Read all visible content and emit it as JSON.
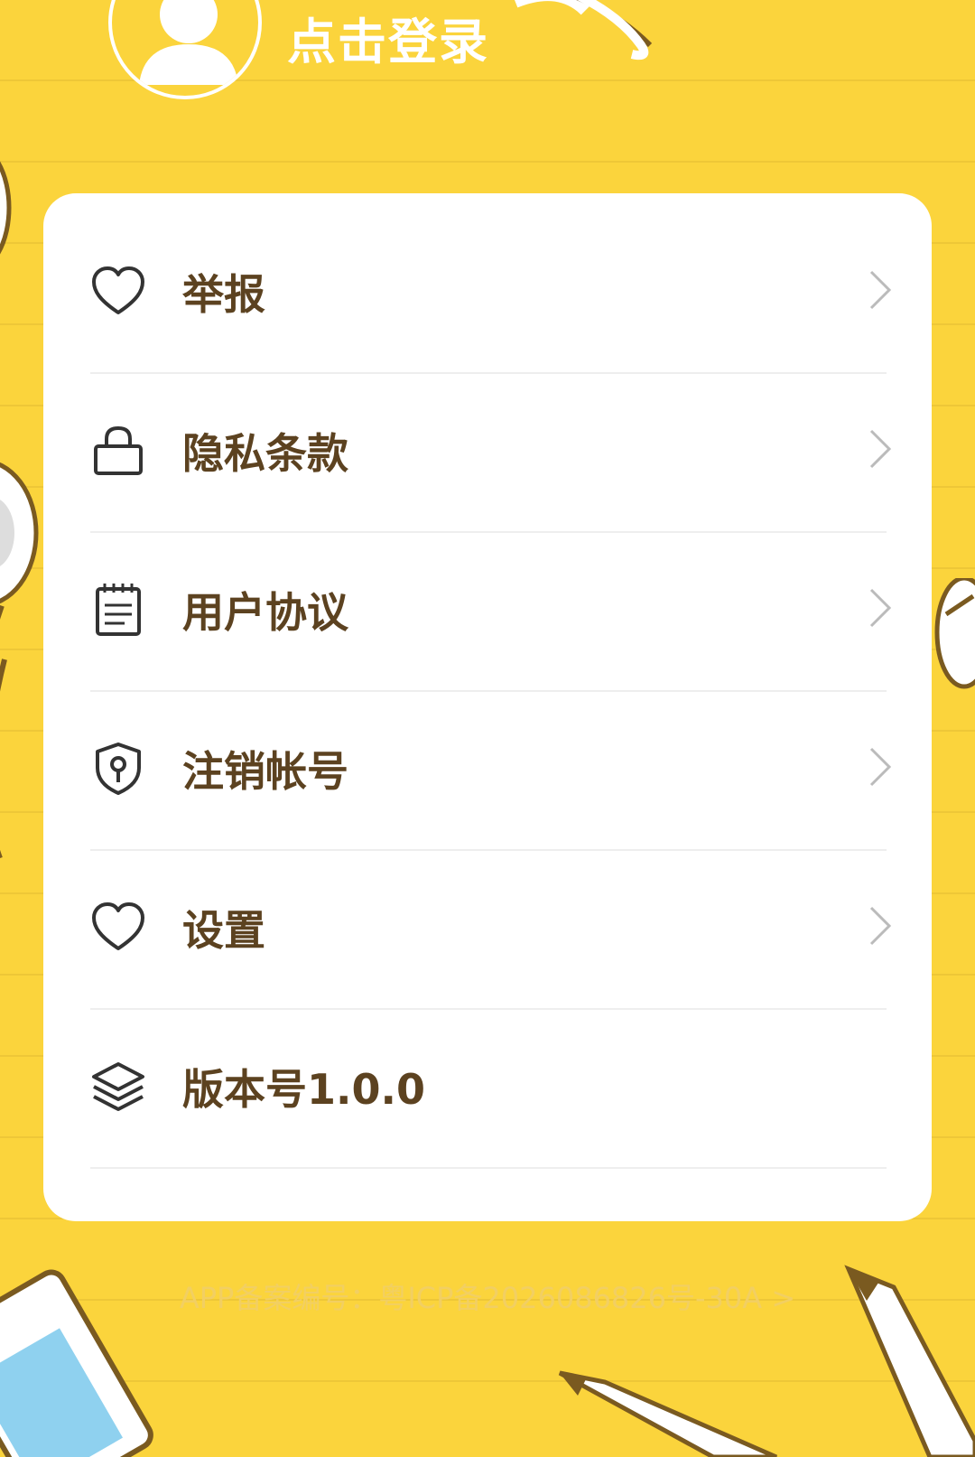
{
  "header": {
    "login_label": "点击登录",
    "avatar_icon": "user-avatar-icon"
  },
  "menu": {
    "items": [
      {
        "label": "举报",
        "icon": "heart-icon",
        "has_chevron": true
      },
      {
        "label": "隐私条款",
        "icon": "lock-icon",
        "has_chevron": true
      },
      {
        "label": "用户协议",
        "icon": "notepad-icon",
        "has_chevron": true
      },
      {
        "label": "注销帐号",
        "icon": "shield-key-icon",
        "has_chevron": true
      },
      {
        "label": "设置",
        "icon": "heart-icon",
        "has_chevron": true
      },
      {
        "label": "版本号1.0.0",
        "icon": "layers-icon",
        "has_chevron": false
      }
    ]
  },
  "footer": {
    "icp_text": "APP备案编号：粤ICP备2026086826号-30A >"
  },
  "colors": {
    "background": "#fbd43c",
    "card": "#ffffff",
    "label_text": "#5c4220",
    "icon_stroke": "#333333",
    "chevron": "#bbbbbb"
  }
}
